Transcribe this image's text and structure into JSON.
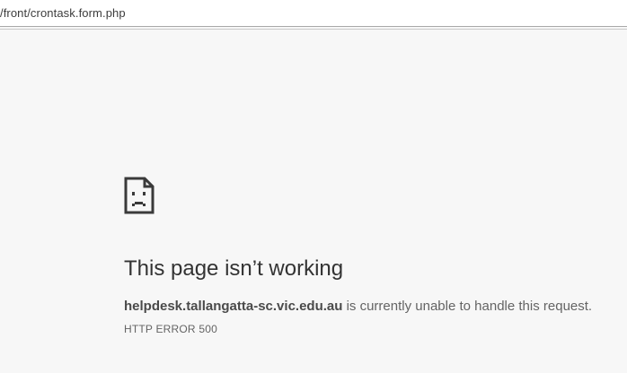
{
  "browser": {
    "url_fragment": "/front/crontask.form.php"
  },
  "error_page": {
    "icon": "sad-page-icon",
    "headline": "This page isn’t working",
    "host": "helpdesk.tallangatta-sc.vic.edu.au",
    "message_suffix": " is currently unable to handle this request.",
    "error_code": "HTTP ERROR 500"
  },
  "colors": {
    "page_background": "#f7f7f7",
    "headline": "#333333",
    "body_text": "#646464"
  }
}
